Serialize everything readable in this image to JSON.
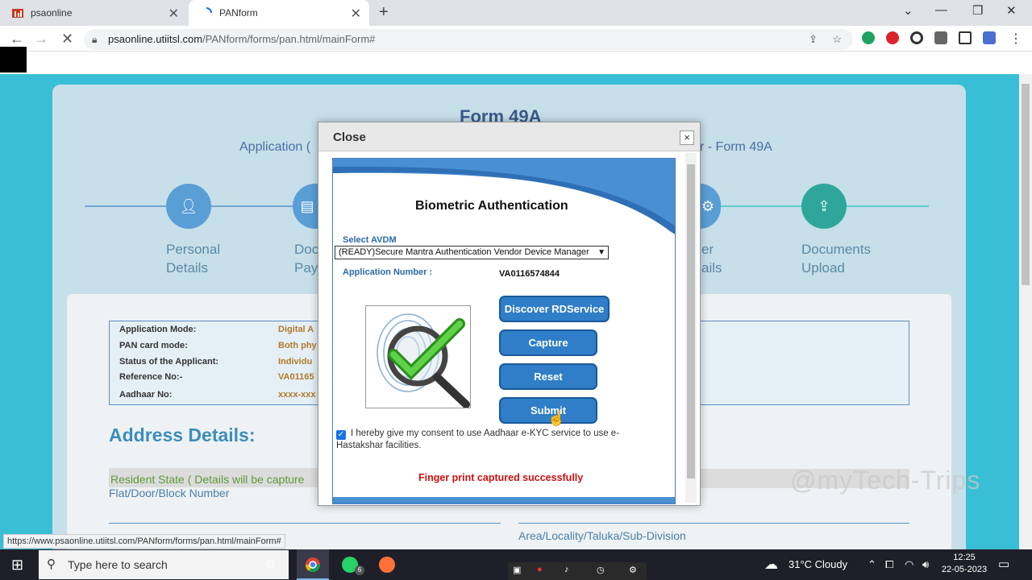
{
  "browser": {
    "tabs": [
      {
        "label": "psaonline"
      },
      {
        "label": "PANform"
      }
    ],
    "url_host": "psaonline.utiitsl.com",
    "url_path": "/PANform/forms/pan.html/mainForm#",
    "status_url": "https://www.psaonline.utiitsl.com/PANform/forms/pan.html/mainForm#"
  },
  "page": {
    "form_title": "Form 49A",
    "subtitle_left": "Application (",
    "subtitle_right": "r - Form 49A",
    "steps": [
      {
        "line1": "Personal",
        "line2": "Details"
      },
      {
        "line1": "Doc",
        "line2": "Pay"
      },
      {
        "line1": "er",
        "line2": "ails"
      },
      {
        "line1": "Documents",
        "line2": "Upload"
      }
    ],
    "info": [
      {
        "label": "Application Mode:",
        "value": "Digital A"
      },
      {
        "label": "PAN card mode:",
        "value": "Both phy"
      },
      {
        "label": "Status of the Applicant:",
        "value": "Individu"
      },
      {
        "label": "Reference No:-",
        "value": "VA01165"
      },
      {
        "label": "Aadhaar No:",
        "value": "xxxx-xxx"
      }
    ],
    "address_heading": "Address Details:",
    "resident_state": "Resident State ( Details will be capture",
    "flat_label": "Flat/Door/Block Number",
    "area_label": "Area/Locality/Taluka/Sub-Division",
    "watermark": "@myTech-Trips"
  },
  "modal": {
    "close_title": "Close",
    "close_x": "×",
    "heading": "Biometric Authentication",
    "select_label": "Select AVDM",
    "select_value": "(READY)Secure Mantra Authentication Vendor Device Manager",
    "app_number_label": "Application Number :",
    "app_number_value": "VA0116574844",
    "buttons": {
      "discover": "Discover RDService",
      "capture": "Capture",
      "reset": "Reset",
      "submit": "Submit"
    },
    "consent": "I hereby give my consent to use Aadhaar e-KYC service to use e-Hastakshar facilities.",
    "success": "Finger print captured successfully"
  },
  "taskbar": {
    "search_placeholder": "Type here to search",
    "weather": "31°C  Cloudy",
    "time": "12:25",
    "date": "22-05-2023",
    "whatsapp_badge": "6"
  }
}
